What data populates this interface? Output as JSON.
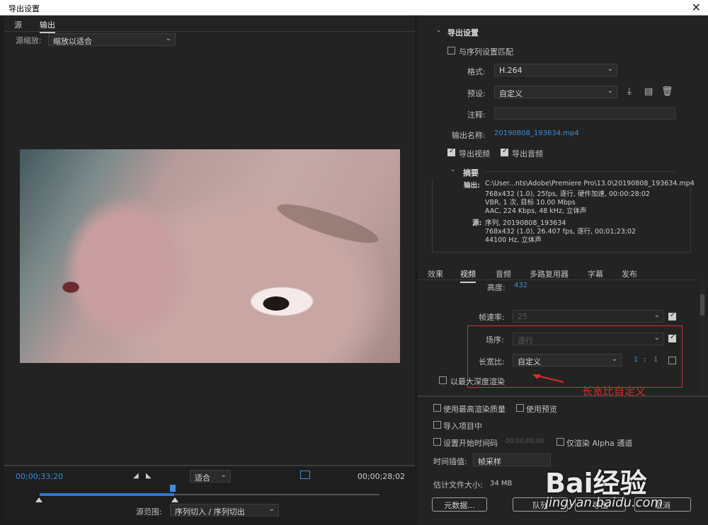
{
  "window": {
    "title": "导出设置",
    "close": "✕"
  },
  "left": {
    "tabs": [
      "源",
      "输出"
    ],
    "zoom_label": "源缩放:",
    "zoom_value": "缩放以适合",
    "timecode_current": "00;00;33;20",
    "timecode_duration": "00;00;28;02",
    "fit_value": "适合",
    "source_range_label": "源范围:",
    "source_range_value": "序列切入 / 序列切出"
  },
  "export": {
    "header": "导出设置",
    "match_sequence": "与序列设置匹配",
    "format_label": "格式:",
    "format_value": "H.264",
    "preset_label": "预设:",
    "preset_value": "自定义",
    "comment_label": "注释:",
    "output_name_label": "输出名称:",
    "output_name_value": "20190808_193634.mp4",
    "export_video": "导出视频",
    "export_audio": "导出音频",
    "summary_header": "摘要",
    "output_label": "输出:",
    "output_lines": [
      "C:\\User...nts\\Adobe\\Premiere Pro\\13.0\\20190808_193634.mp4",
      "768x432 (1.0), 25fps, 逐行, 硬件加速, 00:00:28:02",
      "VBR, 1 次, 目标 10.00 Mbps",
      "AAC, 224 Kbps, 48 kHz, 立体声"
    ],
    "source_label": "源:",
    "source_lines": [
      "序列, 20190808_193634",
      "768x432 (1.0), 26.407 fps, 逐行, 00;01;23;02",
      "44100 Hz, 立体声"
    ]
  },
  "tabs2": [
    "效果",
    "视频",
    "音频",
    "多路复用器",
    "字幕",
    "发布"
  ],
  "video": {
    "height_label": "高度:",
    "height_value": "432",
    "framerate_label": "帧速率:",
    "framerate_value": "25",
    "field_label": "场序:",
    "field_value": "逐行",
    "aspect_label": "长宽比:",
    "aspect_value": "自定义",
    "aspect_num": "1",
    "aspect_sep": ":",
    "aspect_den": "1",
    "max_depth": "以最大深度渲染"
  },
  "bottom": {
    "max_quality": "使用最高渲染质量",
    "use_preview": "使用预览",
    "import_project": "导入项目中",
    "set_start_tc": "设置开始时间码",
    "start_tc_value": "00;00;00;00",
    "alpha_only": "仅渲染 Alpha 通道",
    "interp_label": "时间插值:",
    "interp_value": "帧采样",
    "filesize_label": "估计文件大小:",
    "filesize_value": "34 MB",
    "metadata_btn": "元数据...",
    "queue_btn": "队列",
    "export_btn": "导出",
    "cancel_btn": "取消"
  },
  "annotation": "长宽比自定义",
  "watermark": {
    "logo": "Bai经验",
    "url": "jingyan.baidu.com"
  }
}
